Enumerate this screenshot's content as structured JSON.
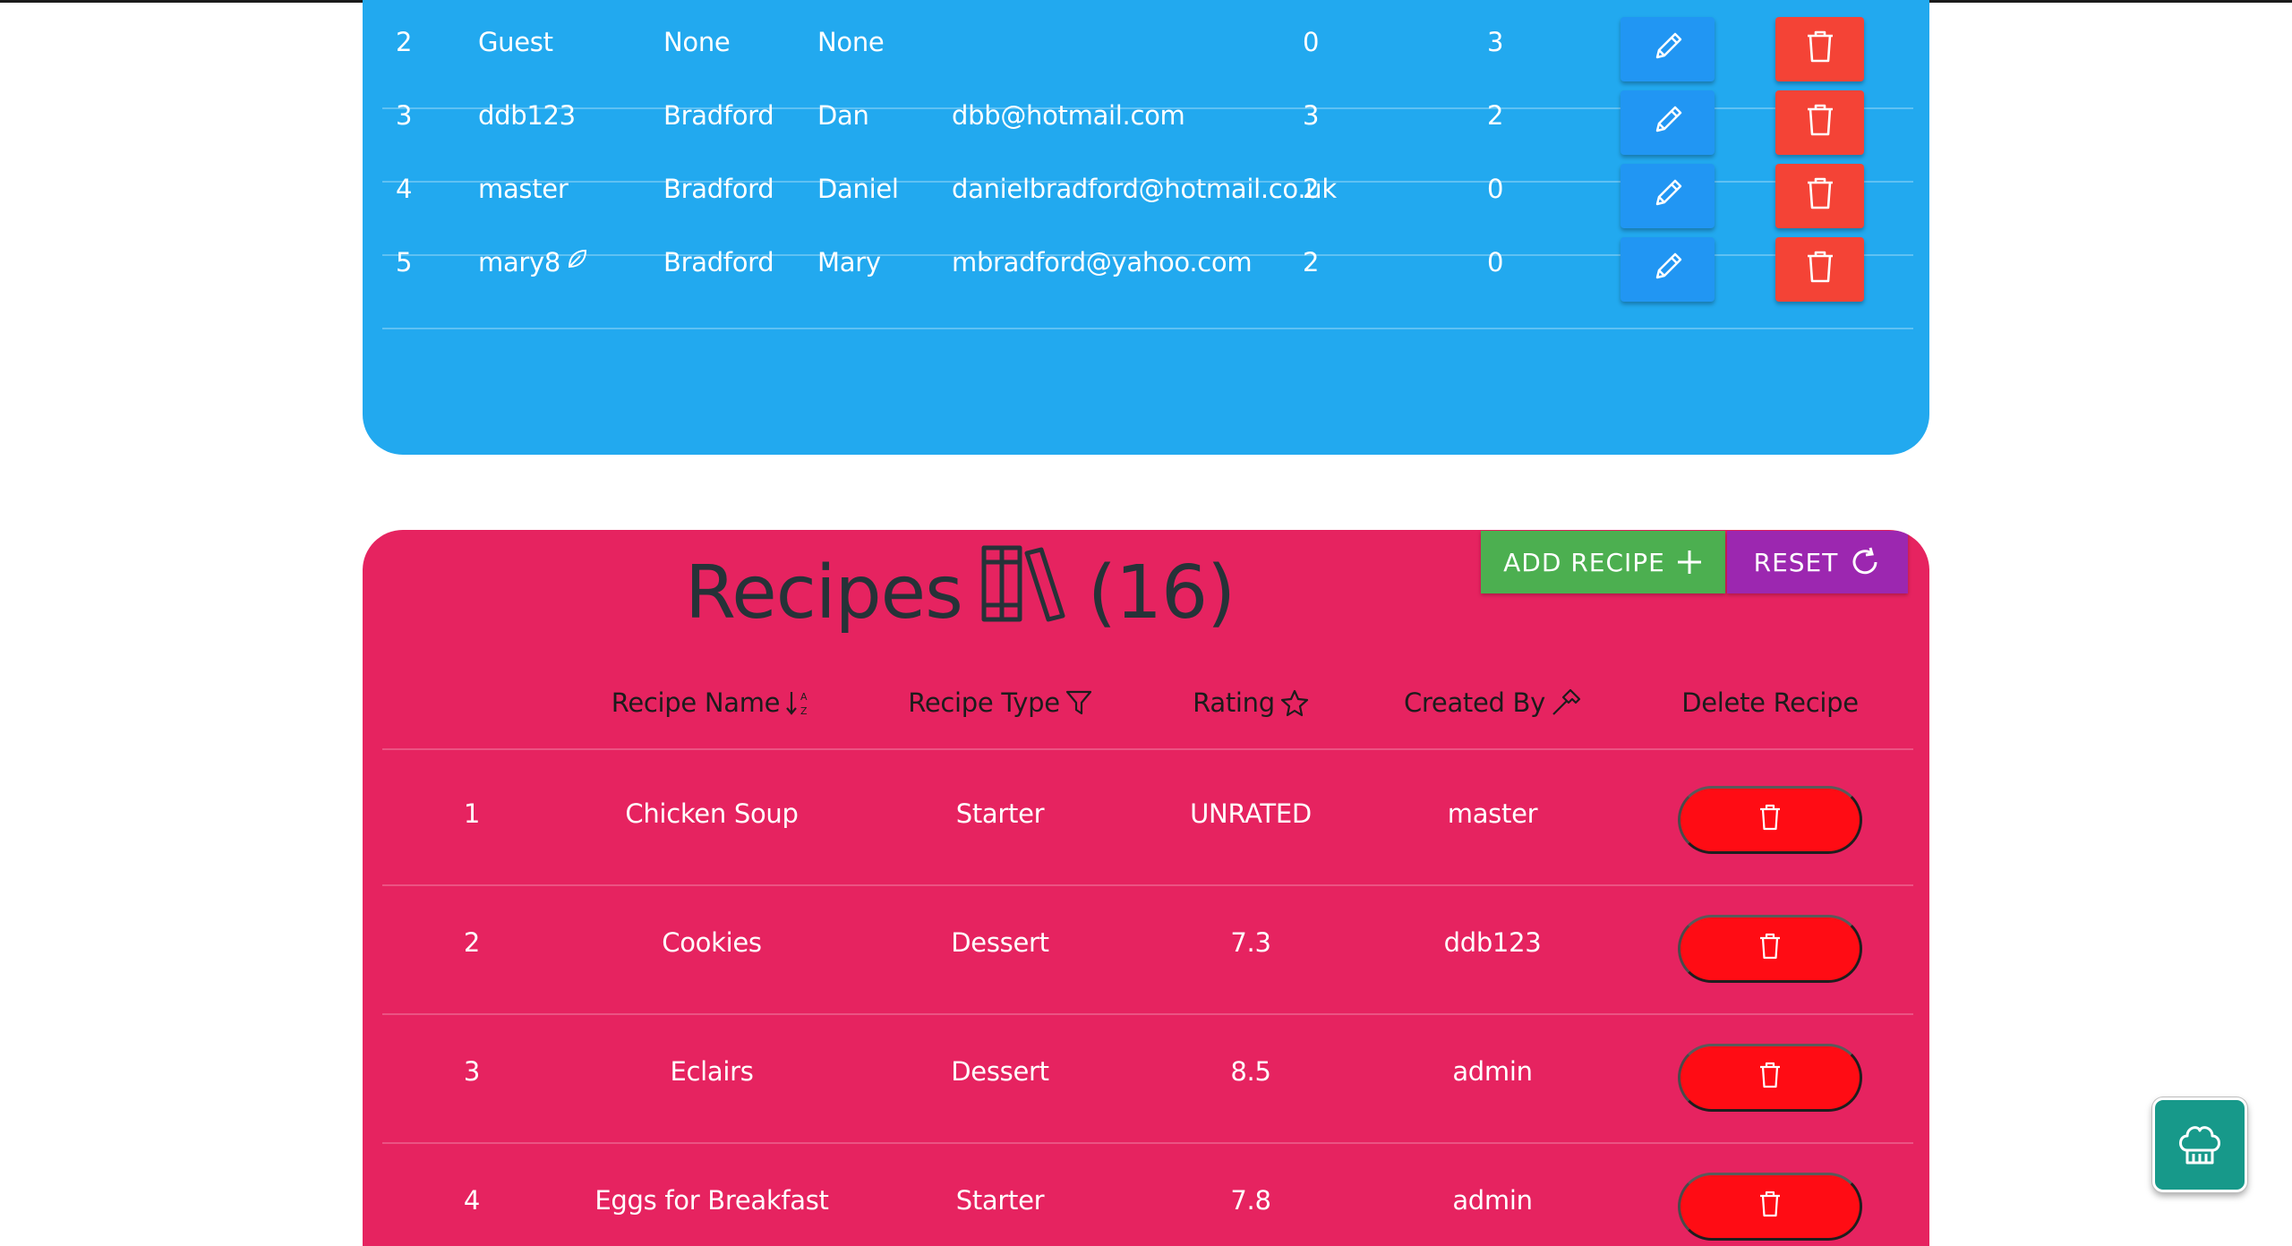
{
  "users": {
    "rows": [
      {
        "id": "2",
        "username": "Guest",
        "last_name": "None",
        "first_name": "None",
        "email": "",
        "n1": "0",
        "n2": "3",
        "has_leaf": false
      },
      {
        "id": "3",
        "username": "ddb123",
        "last_name": "Bradford",
        "first_name": "Dan",
        "email": "dbb@hotmail.com",
        "n1": "3",
        "n2": "2",
        "has_leaf": false
      },
      {
        "id": "4",
        "username": "master",
        "last_name": "Bradford",
        "first_name": "Daniel",
        "email": "danielbradford@hotmail.co.uk",
        "n1": "2",
        "n2": "0",
        "has_leaf": false
      },
      {
        "id": "5",
        "username": "mary8",
        "last_name": "Bradford",
        "first_name": "Mary",
        "email": "mbradford@yahoo.com",
        "n1": "2",
        "n2": "0",
        "has_leaf": true
      }
    ],
    "edit_icon": "pencil-icon",
    "delete_icon": "trash-icon",
    "colors": {
      "panel": "#22a9ef",
      "edit": "#2196f3",
      "delete": "#f44336"
    }
  },
  "recipes": {
    "title": "Recipes",
    "count": "(16)",
    "title_icon": "books-icon",
    "add_label": "ADD RECIPE",
    "reset_label": "RESET",
    "headers": {
      "name": "Recipe Name",
      "type": "Recipe Type",
      "rating": "Rating",
      "created_by": "Created By",
      "delete": "Delete Recipe"
    },
    "rows": [
      {
        "num": "1",
        "name": "Chicken Soup",
        "type": "Starter",
        "rating": "UNRATED",
        "created_by": "master"
      },
      {
        "num": "2",
        "name": "Cookies",
        "type": "Dessert",
        "rating": "7.3",
        "created_by": "ddb123"
      },
      {
        "num": "3",
        "name": "Eclairs",
        "type": "Dessert",
        "rating": "8.5",
        "created_by": "admin"
      },
      {
        "num": "4",
        "name": "Eggs for Breakfast",
        "type": "Starter",
        "rating": "7.8",
        "created_by": "admin"
      }
    ],
    "colors": {
      "panel": "#e62360",
      "add": "#4caf50",
      "reset": "#9c27b0",
      "delete": "#ff0c14"
    }
  },
  "fab": {
    "icon": "chef-hat-icon",
    "color": "#17998a"
  }
}
